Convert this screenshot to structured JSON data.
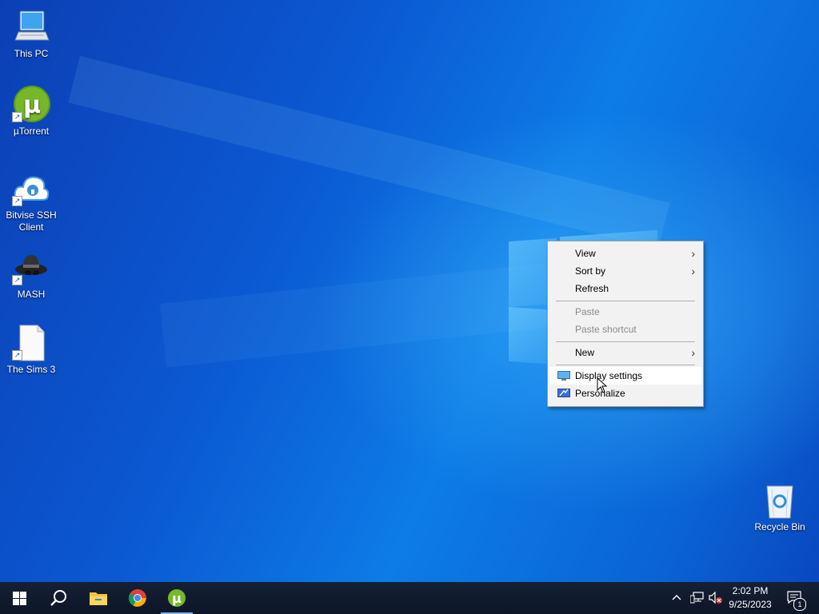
{
  "desktop": {
    "icons": [
      {
        "label": "This PC"
      },
      {
        "label": "µTorrent"
      },
      {
        "label": "Bitvise SSH Client"
      },
      {
        "label": "MASH"
      },
      {
        "label": "The Sims 3"
      },
      {
        "label": "Recycle Bin"
      }
    ]
  },
  "context_menu": {
    "items": [
      {
        "label": "View",
        "submenu": true,
        "enabled": true
      },
      {
        "label": "Sort by",
        "submenu": true,
        "enabled": true
      },
      {
        "label": "Refresh",
        "enabled": true
      },
      {
        "label": "Paste",
        "enabled": false
      },
      {
        "label": "Paste shortcut",
        "enabled": false
      },
      {
        "label": "New",
        "submenu": true,
        "enabled": true
      },
      {
        "label": "Display settings",
        "enabled": true,
        "highlighted": true
      },
      {
        "label": "Personalize",
        "enabled": true
      }
    ],
    "submenu_arrow": "›"
  },
  "taskbar": {
    "pinned": [
      {
        "name": "start-icon"
      },
      {
        "name": "search-icon"
      },
      {
        "name": "file-explorer-icon"
      },
      {
        "name": "chrome-icon"
      },
      {
        "name": "utorrent-icon",
        "active": true
      }
    ],
    "tray": {
      "chevron": "^",
      "clock_time": "2:02 PM",
      "clock_date": "9/25/2023",
      "notification_count": "1"
    }
  },
  "colors": {
    "desktop_blue": "#0a6fd9",
    "taskbar": "#0f1a2b",
    "menu_bg": "#f2f2f2",
    "utorrent_green": "#76b82a"
  }
}
